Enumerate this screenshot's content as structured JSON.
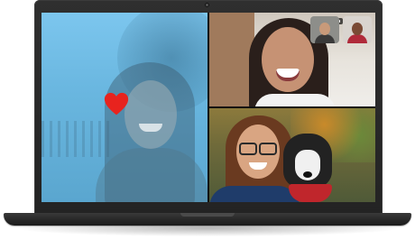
{
  "app": {
    "name": "Video call"
  },
  "colors": {
    "heart": "#e8231e",
    "laptop_body": "#2a2a2a",
    "left_tint": "#6ab7e0"
  },
  "call": {
    "participants": [
      {
        "tile": "left",
        "state": "reacting",
        "reaction_icon": "heart-icon"
      },
      {
        "tile": "top-right",
        "state": "speaking"
      },
      {
        "tile": "bottom-right",
        "state": "with-dog"
      }
    ],
    "self_views": [
      {
        "icon": "avatar"
      },
      {
        "icon": "avatar"
      }
    ],
    "indicator_icon": "mic-icon"
  }
}
